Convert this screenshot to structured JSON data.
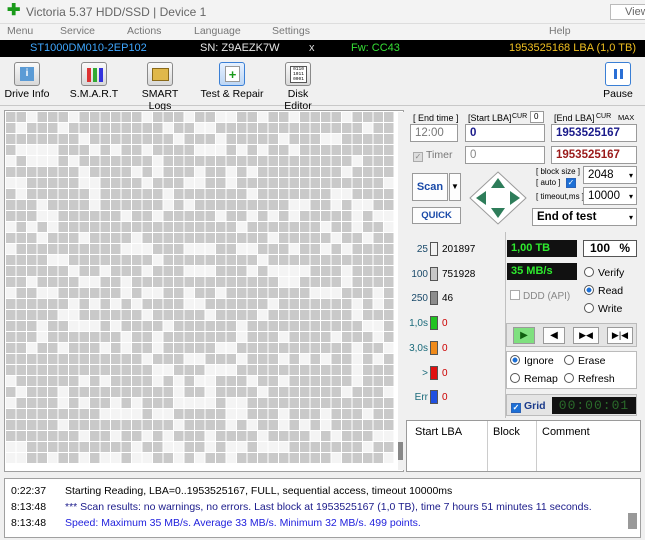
{
  "window": {
    "title": "Victoria 5.37 HDD/SSD | Device 1",
    "view_label": "View"
  },
  "menu": [
    "Menu",
    "Service",
    "Actions",
    "Language",
    "Settings",
    "Help"
  ],
  "device_bar": {
    "model": "ST1000DM010-2EP102",
    "serial": "SN: Z9AEZK7W",
    "close": "x",
    "firmware": "Fw: CC43",
    "lba": "1953525168 LBA (1,0 TB)",
    "colors": {
      "model": "#3fa8ff",
      "serial": "#e8e8e8",
      "firmware": "#35e035",
      "lba": "#f0c020"
    }
  },
  "toolbar": {
    "buttons": [
      {
        "label": "Drive Info",
        "icon": "info-icon"
      },
      {
        "label": "S.M.A.R.T",
        "icon": "smart-icon"
      },
      {
        "label": "SMART Logs",
        "icon": "logs-icon"
      },
      {
        "label": "Test & Repair",
        "icon": "repair-icon",
        "active": true
      },
      {
        "label": "Disk Editor",
        "icon": "disk-editor-icon"
      }
    ],
    "pause_label": "Pause"
  },
  "scan_settings": {
    "end_time_label": "[ End time ]",
    "end_time_value": "12:00",
    "start_lba_label": "[Start LBA]",
    "cur_label": "CUR",
    "start_cur_value": "0",
    "end_lba_label": "[End LBA]",
    "cur2_label": "CUR",
    "max_label": "MAX",
    "start_lba_value": "0",
    "end_lba_value": "1953525167",
    "timer_label": "Timer",
    "timer_value": "0",
    "end_lba_current": "1953525167",
    "scan_label": "Scan",
    "quick_label": "QUICK",
    "block_size_label": "[ block size ]",
    "auto_label": "[ auto ]",
    "block_size_value": "2048",
    "timeout_label": "[ timeout,ms ]",
    "timeout_value": "10000",
    "end_action_value": "End of test"
  },
  "legend": [
    {
      "label": "25",
      "count": "201897",
      "color": "#f2f2f2"
    },
    {
      "label": "100",
      "count": "751928",
      "color": "#c8c8c8"
    },
    {
      "label": "250",
      "count": "46",
      "color": "#8c8c8c"
    },
    {
      "label": "1,0s",
      "count": "0",
      "color": "#22c322"
    },
    {
      "label": "3,0s",
      "count": "0",
      "color": "#f08a1a"
    },
    {
      "label": ">",
      "count": "0",
      "color": "#e01010"
    },
    {
      "label": "Err",
      "count": "0",
      "color": "#2050e0"
    }
  ],
  "status": {
    "capacity": "1,00 TB",
    "percent": "100",
    "percent_unit": "%",
    "speed": "35 MB/s",
    "ddd_label": "DDD (API)",
    "verify_label": "Verify",
    "read_label": "Read",
    "write_label": "Write",
    "ignore_label": "Ignore",
    "erase_label": "Erase",
    "remap_label": "Remap",
    "refresh_label": "Refresh",
    "grid_label": "Grid",
    "elapsed": "00:00:01"
  },
  "table": {
    "columns": [
      "Start LBA",
      "Block",
      "Comment"
    ]
  },
  "log": [
    {
      "time": "0:22:37",
      "message": "Starting Reading, LBA=0..1953525167, FULL, sequential access, timeout 10000ms",
      "color": "#000000"
    },
    {
      "time": "8:13:48",
      "message": "*** Scan results: no warnings, no errors. Last block at 1953525167 (1,0 TB), time 7 hours 51 minutes 11 seconds.",
      "color": "#1a1a8a"
    },
    {
      "time": "8:13:48",
      "message": "Speed: Maximum 35 MB/s. Average 33 MB/s. Minimum 32 MB/s. 499 points.",
      "color": "#2222dd"
    }
  ]
}
